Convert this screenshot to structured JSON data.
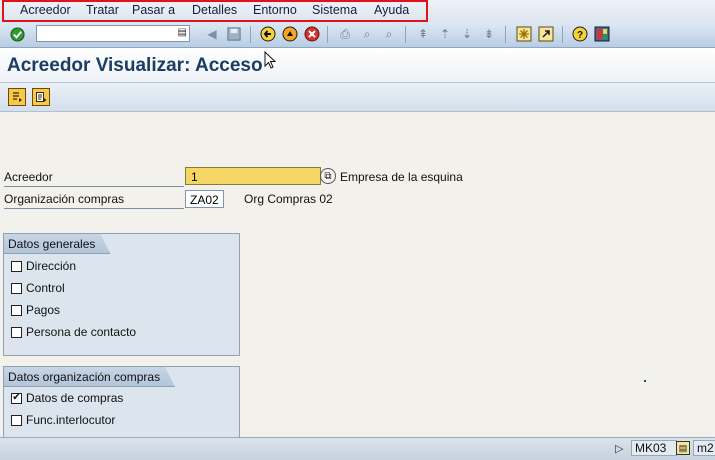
{
  "menu": {
    "items": [
      "Acreedor",
      "Tratar",
      "Pasar a",
      "Detalles",
      "Entorno",
      "Sistema",
      "Ayuda"
    ]
  },
  "toolbar": {
    "command_value": "",
    "icons": [
      "enter-check-icon",
      "history-dropdown-icon",
      "back-triangle-icon",
      "save-icon",
      "back-icon",
      "exit-icon",
      "cancel-icon",
      "print-icon",
      "find-icon",
      "find-next-icon",
      "first-page-icon",
      "previous-page-icon",
      "next-page-icon",
      "last-page-icon",
      "new-session-icon",
      "shortcut-icon",
      "help-icon",
      "layout-icon"
    ]
  },
  "page": {
    "title": "Acreedor Visualizar: Acceso"
  },
  "fields": {
    "vendor": {
      "label": "Acreedor",
      "value": "1",
      "description": "Empresa de la esquina"
    },
    "purchasing_org": {
      "label": "Organización compras",
      "value": "ZA02",
      "description": "Org Compras 02"
    }
  },
  "groups": {
    "general": {
      "title": "Datos generales",
      "items": [
        {
          "label": "Dirección",
          "checked": false
        },
        {
          "label": "Control",
          "checked": false
        },
        {
          "label": "Pagos",
          "checked": false
        },
        {
          "label": "Persona de contacto",
          "checked": false
        }
      ]
    },
    "purchasing": {
      "title": "Datos organización compras",
      "items": [
        {
          "label": "Datos de compras",
          "checked": true
        },
        {
          "label": "Func.interlocutor",
          "checked": false
        }
      ]
    }
  },
  "status": {
    "transaction": "MK03",
    "server": "m2"
  },
  "colors": {
    "highlight": "#e0121c",
    "required_field": "#f5d565",
    "title": "#1b3d63"
  }
}
